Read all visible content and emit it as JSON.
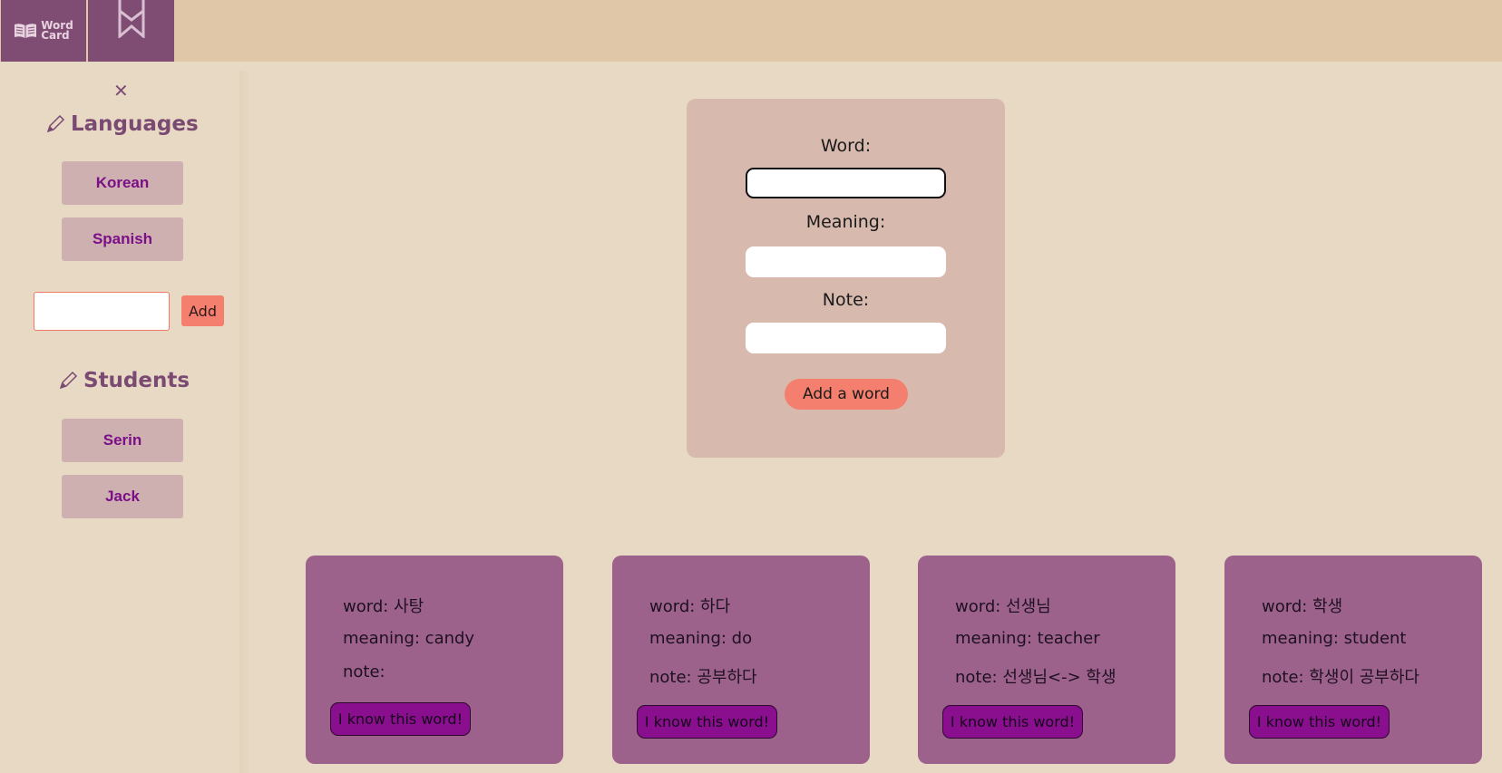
{
  "header": {
    "logo_text_line1": "Word",
    "logo_text_line2": "Card"
  },
  "sidebar": {
    "close_symbol": "✕",
    "languages_heading": "Languages",
    "languages": [
      "Korean",
      "Spanish"
    ],
    "language_input_value": "",
    "add_label": "Add",
    "students_heading": "Students",
    "students": [
      "Serin",
      "Jack"
    ]
  },
  "form": {
    "word_label": "Word:",
    "word_value": "",
    "meaning_label": "Meaning:",
    "meaning_value": "",
    "note_label": "Note:",
    "note_value": "",
    "submit_label": "Add a word"
  },
  "cards": [
    {
      "word": "word: 사탕",
      "meaning": "meaning: candy",
      "note": "note:",
      "button": "I know this word!"
    },
    {
      "word": "word: 하다",
      "meaning": "meaning: do",
      "note": "note: 공부하다",
      "button": "I know this word!"
    },
    {
      "word": "word: 선생님",
      "meaning": "meaning: teacher",
      "note": "note: 선생님<-> 학생",
      "button": "I know this word!"
    },
    {
      "word": "word: 학생",
      "meaning": "meaning: student",
      "note": "note: 학생이 공부하다",
      "button": "I know this word!"
    }
  ],
  "colors": {
    "background": "#e8d9c4",
    "topbar": "#dfc7a8",
    "brand": "#7f4d74",
    "card": "#9d628c",
    "accent": "#f47f6e",
    "form_card": "#d7b9ae"
  },
  "icons": {
    "logo": "open-book-icon",
    "nav": "bookmark-icon",
    "heading": "pencil-icon"
  }
}
